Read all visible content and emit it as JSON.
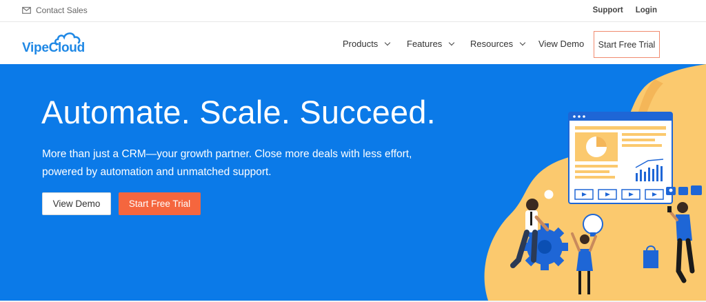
{
  "topbar": {
    "contact_label": "Contact Sales",
    "support_label": "Support",
    "login_label": "Login"
  },
  "logo": {
    "text": "VipeCloud"
  },
  "nav": {
    "products_label": "Products",
    "features_label": "Features",
    "resources_label": "Resources",
    "view_demo_label": "View Demo",
    "start_trial_label": "Start Free Trial"
  },
  "hero": {
    "headline": "Automate. Scale. Succeed.",
    "subtext": "More than just a CRM—your growth partner. Close more deals with less effort, powered by automation and unmatched support.",
    "view_demo_button": "View Demo",
    "start_trial_button": "Start Free Trial"
  },
  "colors": {
    "hero_bg": "#0b7ae8",
    "brand_blue": "#1f88e5",
    "cta_orange": "#f5663e",
    "illustration_yellow": "#fbc96e"
  },
  "icons": {
    "contact": "envelope-icon",
    "menu_dropdown": "chevron-down-icon",
    "logo": "cloud-icon"
  }
}
